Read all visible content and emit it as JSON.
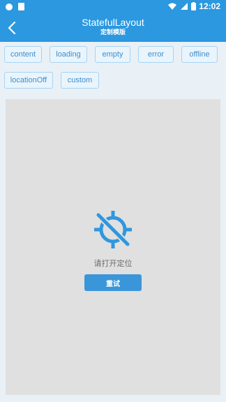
{
  "status_bar": {
    "time": "12:02"
  },
  "app_bar": {
    "title": "StatefulLayout",
    "subtitle": "定制模版",
    "back_icon": "arrow-back-icon"
  },
  "state_buttons": [
    "content",
    "loading",
    "empty",
    "error",
    "offline",
    "locationOff",
    "custom"
  ],
  "state_view": {
    "message": "请打开定位",
    "button": "重试",
    "icon": "location-off-icon"
  },
  "colors": {
    "primary": "#2b98e0",
    "chip_border": "#a6d3f4",
    "chip_text": "#3d8fcf",
    "panel_bg": "#e0e0e0",
    "retry_bg": "#3b96d9"
  }
}
